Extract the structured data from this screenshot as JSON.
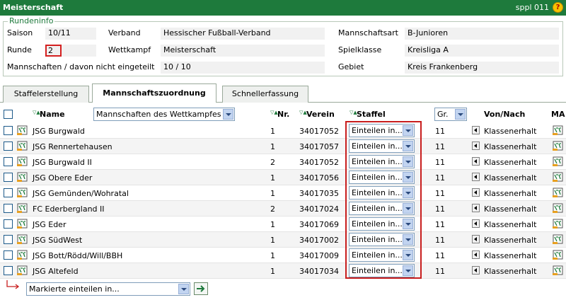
{
  "header": {
    "title": "Meisterschaft",
    "user": "sppl 011",
    "help_icon": "?"
  },
  "rundeninfo": {
    "legend": "Rundeninfo",
    "saison_label": "Saison",
    "saison_value": "10/11",
    "verband_label": "Verband",
    "verband_value": "Hessischer Fußball-Verband",
    "mannschaftsart_label": "Mannschaftsart",
    "mannschaftsart_value": "B-Junioren",
    "runde_label": "Runde",
    "runde_value": "2",
    "wettkampf_label": "Wettkampf",
    "wettkampf_value": "Meisterschaft",
    "spielklasse_label": "Spielklasse",
    "spielklasse_value": "Kreisliga A",
    "mannschaften_label": "Mannschaften / davon nicht eingeteilt",
    "mannschaften_value": "10 / 10",
    "gebiet_label": "Gebiet",
    "gebiet_value": "Kreis Frankenberg"
  },
  "tabs": [
    {
      "label": "Staffelerstellung",
      "active": false
    },
    {
      "label": "Mannschaftszuordnung",
      "active": true
    },
    {
      "label": "Schnellerfassung",
      "active": false
    }
  ],
  "table": {
    "col_name": "Name",
    "filter_select": "Mannschaften des Wettkampfes",
    "col_nr": "Nr.",
    "col_verein": "Verein",
    "col_staffel": "Staffel",
    "gr_select": "Gr.",
    "col_von_nach": "Von/Nach",
    "col_ma": "MA",
    "sort_icon": "▽▲",
    "rows": [
      {
        "name": "JSG Burgwald",
        "nr": "1",
        "verein": "34017052",
        "staffel": "Einteilen in...",
        "gr": "11",
        "von_nach": "Klassenerhalt"
      },
      {
        "name": "JSG Rennertehausen",
        "nr": "1",
        "verein": "34017057",
        "staffel": "Einteilen in...",
        "gr": "11",
        "von_nach": "Klassenerhalt"
      },
      {
        "name": "JSG Burgwald II",
        "nr": "2",
        "verein": "34017052",
        "staffel": "Einteilen in...",
        "gr": "11",
        "von_nach": "Klassenerhalt"
      },
      {
        "name": "JSG Obere Eder",
        "nr": "1",
        "verein": "34017056",
        "staffel": "Einteilen in...",
        "gr": "11",
        "von_nach": "Klassenerhalt"
      },
      {
        "name": "JSG Gemünden/Wohratal",
        "nr": "1",
        "verein": "34017035",
        "staffel": "Einteilen in...",
        "gr": "11",
        "von_nach": "Klassenerhalt"
      },
      {
        "name": "FC Ederbergland II",
        "nr": "2",
        "verein": "34017024",
        "staffel": "Einteilen in...",
        "gr": "11",
        "von_nach": "Klassenerhalt"
      },
      {
        "name": "JSG Eder",
        "nr": "1",
        "verein": "34017069",
        "staffel": "Einteilen in...",
        "gr": "11",
        "von_nach": "Klassenerhalt"
      },
      {
        "name": "JSG SüdWest",
        "nr": "1",
        "verein": "34017002",
        "staffel": "Einteilen in...",
        "gr": "11",
        "von_nach": "Klassenerhalt"
      },
      {
        "name": "JSG Bott/Rödd/Will/BBH",
        "nr": "1",
        "verein": "34017009",
        "staffel": "Einteilen in...",
        "gr": "11",
        "von_nach": "Klassenerhalt"
      },
      {
        "name": "JSG Altefeld",
        "nr": "1",
        "verein": "34017034",
        "staffel": "Einteilen in...",
        "gr": "11",
        "von_nach": "Klassenerhalt"
      }
    ]
  },
  "footer": {
    "bulk_select": "Markierte einteilen in...",
    "go_icon": "arrow-right-icon"
  },
  "colors": {
    "header_green": "#1e7a3c",
    "highlight_red": "#c81e1e"
  }
}
